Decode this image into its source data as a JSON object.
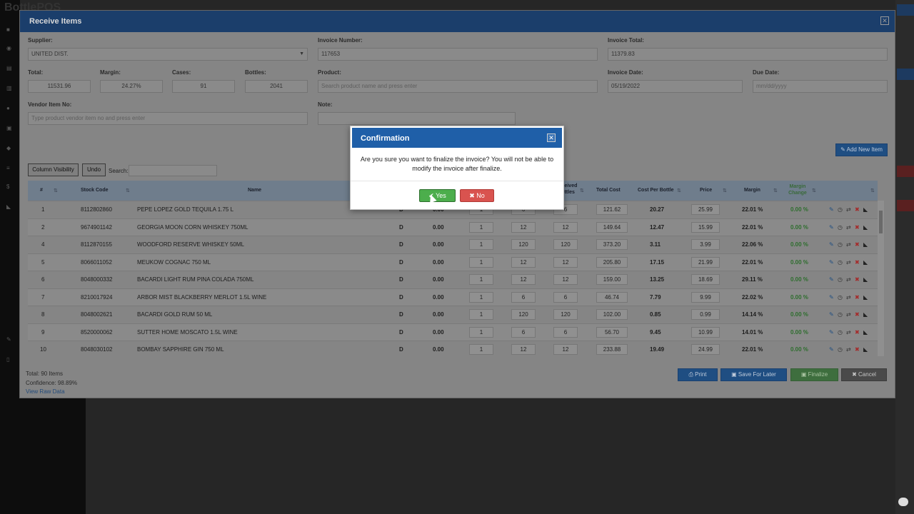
{
  "app": {
    "brand": "BottlePOS"
  },
  "modal": {
    "title": "Receive Items",
    "supplier": {
      "label": "Supplier:",
      "value": "UNITED DIST."
    },
    "invoice_number": {
      "label": "Invoice Number:",
      "value": "117653"
    },
    "invoice_total": {
      "label": "Invoice Total:",
      "value": "11379.83"
    },
    "total": {
      "label": "Total:",
      "value": "11531.96"
    },
    "margin": {
      "label": "Margin:",
      "value": "24.27%"
    },
    "cases": {
      "label": "Cases:",
      "value": "91"
    },
    "bottles": {
      "label": "Bottles:",
      "value": "2041"
    },
    "product": {
      "label": "Product:",
      "placeholder": "Search product name and press enter"
    },
    "invoice_date": {
      "label": "Invoice Date:",
      "value": "05/19/2022"
    },
    "due_date": {
      "label": "Due Date:",
      "placeholder": "mm/dd/yyyy"
    },
    "vendor_item": {
      "label": "Vendor Item No:",
      "placeholder": "Type product vendor item no and press enter"
    },
    "note": {
      "label": "Note:"
    },
    "add_new_item": "Add New Item",
    "column_visibility": "Column Visibility",
    "undo": "Undo",
    "search_label": "Search:"
  },
  "table": {
    "headers": {
      "num": "#",
      "stock_code": "Stock Code",
      "name": "Name",
      "received": "Received Bottles",
      "total_cost": "Total Cost",
      "cost_per_bottle": "Cost Per Bottle",
      "price": "Price",
      "margin": "Margin",
      "margin_change": "Margin Change"
    },
    "rows": [
      {
        "num": "1",
        "code": "8112802860",
        "name": "PEPE LOPEZ GOLD TEQUILA 1.75 L",
        "type": "D",
        "amt": "0.00",
        "qty": "1",
        "units": "6",
        "bottles": "6",
        "total_cost": "121.62",
        "cpb": "20.27",
        "price": "25.99",
        "margin": "22.01 %",
        "change": "0.00 %"
      },
      {
        "num": "2",
        "code": "9674901142",
        "name": "GEORGIA MOON CORN WHISKEY 750ML",
        "type": "D",
        "amt": "0.00",
        "qty": "1",
        "units": "12",
        "bottles": "12",
        "total_cost": "149.64",
        "cpb": "12.47",
        "price": "15.99",
        "margin": "22.01 %",
        "change": "0.00 %"
      },
      {
        "num": "4",
        "code": "8112870155",
        "name": "WOODFORD RESERVE WHISKEY 50ML",
        "type": "D",
        "amt": "0.00",
        "qty": "1",
        "units": "120",
        "bottles": "120",
        "total_cost": "373.20",
        "cpb": "3.11",
        "price": "3.99",
        "margin": "22.06 %",
        "change": "0.00 %"
      },
      {
        "num": "5",
        "code": "8066011052",
        "name": "MEUKOW COGNAC 750 ML",
        "type": "D",
        "amt": "0.00",
        "qty": "1",
        "units": "12",
        "bottles": "12",
        "total_cost": "205.80",
        "cpb": "17.15",
        "price": "21.99",
        "margin": "22.01 %",
        "change": "0.00 %"
      },
      {
        "num": "6",
        "code": "8048000332",
        "name": "BACARDI LIGHT RUM PINA COLADA 750ML",
        "type": "D",
        "amt": "0.00",
        "qty": "1",
        "units": "12",
        "bottles": "12",
        "total_cost": "159.00",
        "cpb": "13.25",
        "price": "18.69",
        "margin": "29.11 %",
        "change": "0.00 %"
      },
      {
        "num": "7",
        "code": "8210017924",
        "name": "ARBOR MIST BLACKBERRY MERLOT 1.5L WINE",
        "type": "D",
        "amt": "0.00",
        "qty": "1",
        "units": "6",
        "bottles": "6",
        "total_cost": "46.74",
        "cpb": "7.79",
        "price": "9.99",
        "margin": "22.02 %",
        "change": "0.00 %"
      },
      {
        "num": "8",
        "code": "8048002621",
        "name": "BACARDI GOLD RUM 50 ML",
        "type": "D",
        "amt": "0.00",
        "qty": "1",
        "units": "120",
        "bottles": "120",
        "total_cost": "102.00",
        "cpb": "0.85",
        "price": "0.99",
        "margin": "14.14 %",
        "change": "0.00 %"
      },
      {
        "num": "9",
        "code": "8520000062",
        "name": "SUTTER HOME MOSCATO 1.5L WINE",
        "type": "D",
        "amt": "0.00",
        "qty": "1",
        "units": "6",
        "bottles": "6",
        "total_cost": "56.70",
        "cpb": "9.45",
        "price": "10.99",
        "margin": "14.01 %",
        "change": "0.00 %"
      },
      {
        "num": "10",
        "code": "8048030102",
        "name": "BOMBAY SAPPHIRE GIN 750 ML",
        "type": "D",
        "amt": "0.00",
        "qty": "1",
        "units": "12",
        "bottles": "12",
        "total_cost": "233.88",
        "cpb": "19.49",
        "price": "24.99",
        "margin": "22.01 %",
        "change": "0.00 %"
      }
    ]
  },
  "footer": {
    "total_items": "Total: 90 Items",
    "confidence": "Confidence: 98.89%",
    "raw_data": "View Raw Data",
    "print": "Print",
    "save_later": "Save For Later",
    "finalize": "Finalize",
    "cancel": "Cancel"
  },
  "dialog": {
    "title": "Confirmation",
    "message": "Are you sure you want to finalize the invoice? You will not be able to modify the invoice after finalize.",
    "yes": "Yes",
    "no": "No"
  },
  "colors": {
    "header_blue": "#1b3e6b",
    "dialog_blue": "#1f5fa8",
    "yes_green": "#4cae4c",
    "no_red": "#d9534f"
  }
}
